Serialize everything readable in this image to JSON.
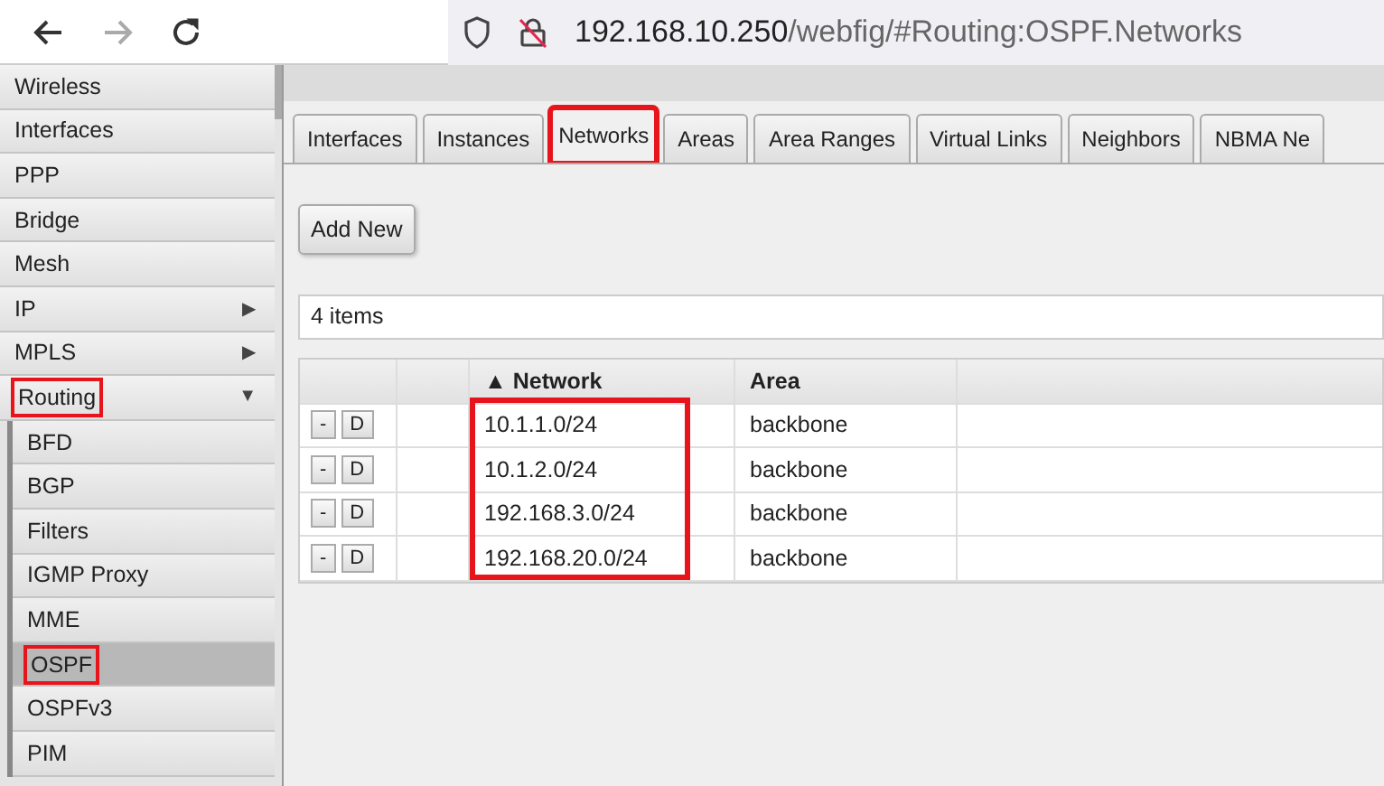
{
  "browser": {
    "url_host": "192.168.10.250",
    "url_path": "/webfig/#Routing:OSPF.Networks"
  },
  "sidebar": {
    "items": [
      {
        "label": "Wireless",
        "selected": false,
        "highlighted": false
      },
      {
        "label": "Interfaces",
        "selected": false,
        "highlighted": false
      },
      {
        "label": "PPP",
        "selected": false,
        "highlighted": false
      },
      {
        "label": "Bridge",
        "selected": false,
        "highlighted": false
      },
      {
        "label": "Mesh",
        "selected": false,
        "highlighted": false
      },
      {
        "label": "IP",
        "arrow": "▶",
        "selected": false,
        "highlighted": false
      },
      {
        "label": "MPLS",
        "arrow": "▶",
        "selected": false,
        "highlighted": false
      },
      {
        "label": "Routing",
        "arrow": "▼",
        "selected": false,
        "highlighted": true,
        "children": [
          {
            "label": "BFD",
            "selected": false,
            "highlighted": false
          },
          {
            "label": "BGP",
            "selected": false,
            "highlighted": false
          },
          {
            "label": "Filters",
            "selected": false,
            "highlighted": false
          },
          {
            "label": "IGMP Proxy",
            "selected": false,
            "highlighted": false
          },
          {
            "label": "MME",
            "selected": false,
            "highlighted": false
          },
          {
            "label": "OSPF",
            "selected": true,
            "highlighted": true
          },
          {
            "label": "OSPFv3",
            "selected": false,
            "highlighted": false
          },
          {
            "label": "PIM",
            "selected": false,
            "highlighted": false
          }
        ]
      }
    ]
  },
  "tabs": [
    {
      "label": "Interfaces",
      "selected": false,
      "highlighted": false
    },
    {
      "label": "Instances",
      "selected": false,
      "highlighted": false
    },
    {
      "label": "Networks",
      "selected": true,
      "highlighted": true
    },
    {
      "label": "Areas",
      "selected": false,
      "highlighted": false
    },
    {
      "label": "Area Ranges",
      "selected": false,
      "highlighted": false
    },
    {
      "label": "Virtual Links",
      "selected": false,
      "highlighted": false
    },
    {
      "label": "Neighbors",
      "selected": false,
      "highlighted": false
    },
    {
      "label": "NBMA Ne",
      "selected": false,
      "highlighted": false
    }
  ],
  "add_button": "Add New",
  "item_count": "4 items",
  "table": {
    "columns": [
      {
        "label": "Network",
        "sort_mark": "▲",
        "highlighted": true
      },
      {
        "label": "Area",
        "highlighted": false
      }
    ],
    "rows": [
      {
        "buttons": [
          "-",
          "D"
        ],
        "network": "10.1.1.0/24",
        "area": "backbone"
      },
      {
        "buttons": [
          "-",
          "D"
        ],
        "network": "10.1.2.0/24",
        "area": "backbone"
      },
      {
        "buttons": [
          "-",
          "D"
        ],
        "network": "192.168.3.0/24",
        "area": "backbone"
      },
      {
        "buttons": [
          "-",
          "D"
        ],
        "network": "192.168.20.0/24",
        "area": "backbone"
      }
    ]
  }
}
